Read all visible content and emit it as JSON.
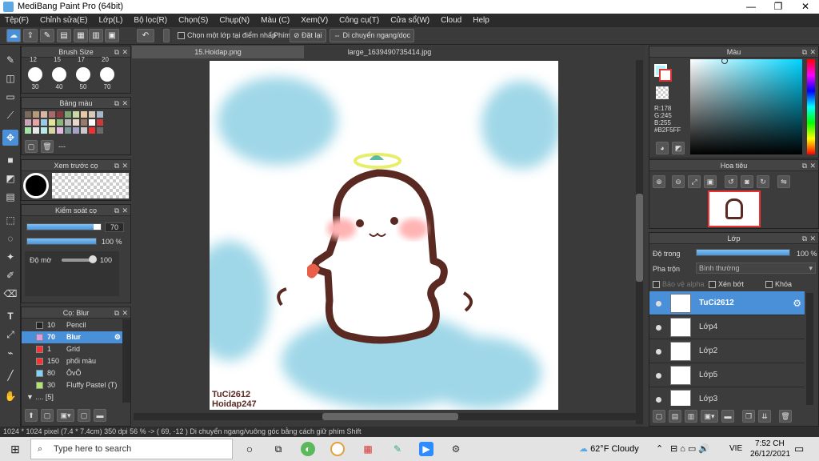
{
  "window": {
    "title": "MediBang Paint Pro (64bit)",
    "minimize": "—",
    "maximize": "❐",
    "close": "✕"
  },
  "menu": [
    "Tệp(F)",
    "Chỉnh sửa(E)",
    "Lớp(L)",
    "Bộ lọc(R)",
    "Chọn(S)",
    "Chụp(N)",
    "Màu (C)",
    "Xem(V)",
    "Công cụ(T)",
    "Cửa sổ(W)",
    "Cloud",
    "Help"
  ],
  "toolbar": {
    "select_layer_label": "Chọn một lớp tại điểm nhấp",
    "shortcut_label": "Phím",
    "reset_label": "Đặt lại",
    "move_label": "Di chuyển ngang/dọc"
  },
  "tabs": [
    {
      "label": "15.Hoidap.png",
      "active": true
    },
    {
      "label": "large_1639490735414.jpg",
      "active": false
    }
  ],
  "brush_size": {
    "title": "Brush Size",
    "top_sizes": [
      "12",
      "15",
      "17",
      "20"
    ],
    "sizes": [
      "30",
      "40",
      "50",
      "70"
    ]
  },
  "palette": {
    "title": "Bảng màu",
    "entry": "---"
  },
  "brush_preview": {
    "title": "Xem trước cọ"
  },
  "brush_control": {
    "title": "Kiểm soát cọ",
    "size_value": "70",
    "size_fraction": 0.9,
    "opacity_value": "100 %",
    "opacity_fraction": 1.0,
    "hardness_label": "Độ mờ",
    "hardness_value": "100"
  },
  "brush_list": {
    "title": "Cọ: Blur",
    "items": [
      {
        "color": "#222222",
        "size": "10",
        "name": "Pencil",
        "selected": false
      },
      {
        "color": "#e39be0",
        "size": "70",
        "name": "Blur",
        "selected": true
      },
      {
        "color": "#ff3030",
        "size": "1",
        "name": "Grid",
        "selected": false
      },
      {
        "color": "#ff3030",
        "size": "150",
        "name": "phối màu",
        "selected": false
      },
      {
        "color": "#7fd4ff",
        "size": "80",
        "name": "ÔvÔ",
        "selected": false
      },
      {
        "color": "#b7e36a",
        "size": "30",
        "name": "Fluffy Pastel (T)",
        "selected": false
      }
    ],
    "group": ".... [5]"
  },
  "color_panel": {
    "title": "Màu",
    "r": "R:178",
    "g": "G:245",
    "b": "B:255",
    "hex": "#B2F5FF",
    "current_color": "#B2F5FF"
  },
  "navigator": {
    "title": "Hoa tiêu"
  },
  "layers": {
    "title": "Lớp",
    "opacity_label": "Độ trong",
    "opacity_value": "100 %",
    "opacity_fraction": 1.0,
    "blend_label": "Pha trộn",
    "blend_value": "Bình thường",
    "protect_alpha": "Bảo vệ alpha",
    "clip": "Xén bớt",
    "lock": "Khóa",
    "items": [
      {
        "name": "TuCi2612",
        "selected": true
      },
      {
        "name": "Lớp4",
        "selected": false
      },
      {
        "name": "Lớp2",
        "selected": false
      },
      {
        "name": "Lớp5",
        "selected": false
      },
      {
        "name": "Lớp3",
        "selected": false
      }
    ]
  },
  "canvas": {
    "watermark_1": "TuCi2612",
    "watermark_2": "Hoidap247"
  },
  "status": "1024 * 1024 pixel  (7.4 * 7.4cm)  350 dpi  56 %  -> ( 69, -12 )  Di chuyển ngang/vuông góc bằng cách giữ phím Shift",
  "taskbar": {
    "search_placeholder": "Type here to search",
    "weather": "62°F  Cloudy",
    "lang": "VIE",
    "time": "7:52 CH",
    "date": "26/12/2021"
  }
}
